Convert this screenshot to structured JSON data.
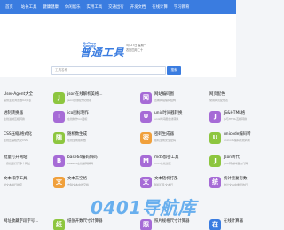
{
  "nav": [
    "首页",
    "站长工具",
    "健康健康",
    "休闲娱乐",
    "实用工具",
    "交通出行",
    "开发文档",
    "在线计算",
    "学习教育"
  ],
  "logo": {
    "en": "PuTong\nGongJu",
    "cn": "普通工具"
  },
  "date": {
    "line1": "5月27日 星期一",
    "line2": "农历四月二十"
  },
  "search": {
    "placeholder": "工具名称",
    "button": "搜索"
  },
  "colors": {
    "nav": "#3a7ce0",
    "accent": "#3a7ce0"
  },
  "tools": [
    {
      "title": "User-Agent大全",
      "desc": "提供主流浏览器UA列表",
      "icon": "",
      "color": ""
    },
    {
      "title": "json在线解析美格...",
      "desc": "json在线格式化校验",
      "icon": "J",
      "color": "#8dc63f"
    },
    {
      "title": "网站编码图",
      "desc": "查看网站编码结构",
      "icon": "网",
      "color": "#a66bd6"
    },
    {
      "title": "网页配色",
      "desc": "常用网页配色表",
      "icon": "",
      "color": ""
    },
    {
      "title": "进制转换器",
      "desc": "在线进制互相转换",
      "icon": "",
      "color": ""
    },
    {
      "title": "ico图标制作",
      "desc": "在线制作ico图标",
      "icon": "I",
      "color": "#a66bd6"
    },
    {
      "title": "unix时间戳转换",
      "desc": "unix时间戳在线转换",
      "icon": "U",
      "color": "#a66bd6"
    },
    {
      "title": "JS&HTML格",
      "desc": "JS与HTML互相转换",
      "icon": "J",
      "color": "#a66bd6"
    },
    {
      "title": "CSS压缩/格式化",
      "desc": "在线压缩格式化CSS",
      "icon": "",
      "color": ""
    },
    {
      "title": "随机数生成",
      "desc": "在线生成随机数",
      "icon": "随",
      "color": "#8dc63f"
    },
    {
      "title": "密码生成器",
      "desc": "随机生成安全密码",
      "icon": "密",
      "color": "#f0a03c"
    },
    {
      "title": "unicode编码转",
      "desc": "unicode编码在线转换",
      "icon": "U",
      "color": "#8dc63f"
    },
    {
      "title": "批量打开网站",
      "desc": "一键批量打开多个网址",
      "icon": "",
      "color": ""
    },
    {
      "title": "base64编码解码",
      "desc": "base64在线编码解码",
      "icon": "B",
      "color": "#a66bd6"
    },
    {
      "title": "md5加密工具",
      "desc": "md5在线加密",
      "icon": "M",
      "color": "#a66bd6"
    },
    {
      "title": "Json转代",
      "desc": "Json转各种语言代码",
      "icon": "J",
      "color": "#8dc63f"
    },
    {
      "title": "文本排序工具",
      "desc": "对文本进行排序",
      "icon": "",
      "color": ""
    },
    {
      "title": "文本去空格",
      "desc": "去除文本中的空格",
      "icon": "文",
      "color": "#f0a03c"
    },
    {
      "title": "文本随机打乱",
      "desc": "随机打乱文本行",
      "icon": "文",
      "color": "#a66bd6"
    },
    {
      "title": "统计重复行数",
      "desc": "统计文本中重复的行",
      "icon": "统",
      "color": "#a66bd6"
    }
  ],
  "bottom": [
    {
      "title": "网址收藏字段字号...",
      "desc": "",
      "icon": "",
      "color": ""
    },
    {
      "title": "纸张开数尺寸计算器",
      "desc": "",
      "icon": "纸",
      "color": "#8dc63f"
    },
    {
      "title": "照片规格尺寸计算器",
      "desc": "",
      "icon": "照",
      "color": "#a66bd6"
    },
    {
      "title": "在线计算器",
      "desc": "",
      "icon": "在",
      "color": "#3a7ce0"
    }
  ],
  "watermark": "0401导航库"
}
